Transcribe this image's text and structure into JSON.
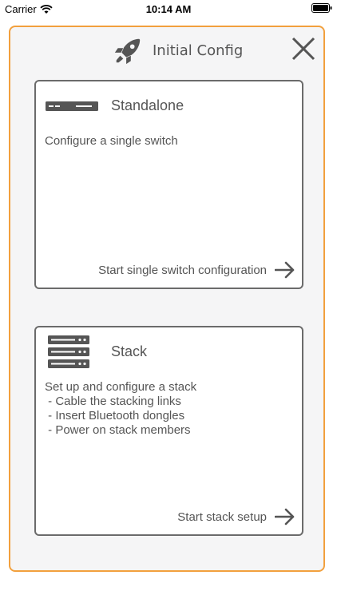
{
  "status_bar": {
    "carrier": "Carrier",
    "time": "10:14 AM"
  },
  "modal": {
    "title": "Initial Config",
    "icons": {
      "header": "rocket-icon",
      "close": "close-icon"
    },
    "accent_color": "#f2a03d"
  },
  "cards": {
    "standalone": {
      "title": "Standalone",
      "description": [
        "Configure a single switch"
      ],
      "action_label": "Start single switch configuration",
      "icon": "switch-icon"
    },
    "stack": {
      "title": "Stack",
      "description": [
        "Set up and configure a stack",
        " - Cable the stacking links",
        " - Insert Bluetooth dongles",
        " - Power on stack members"
      ],
      "action_label": "Start stack setup",
      "icon": "stack-icon"
    }
  }
}
